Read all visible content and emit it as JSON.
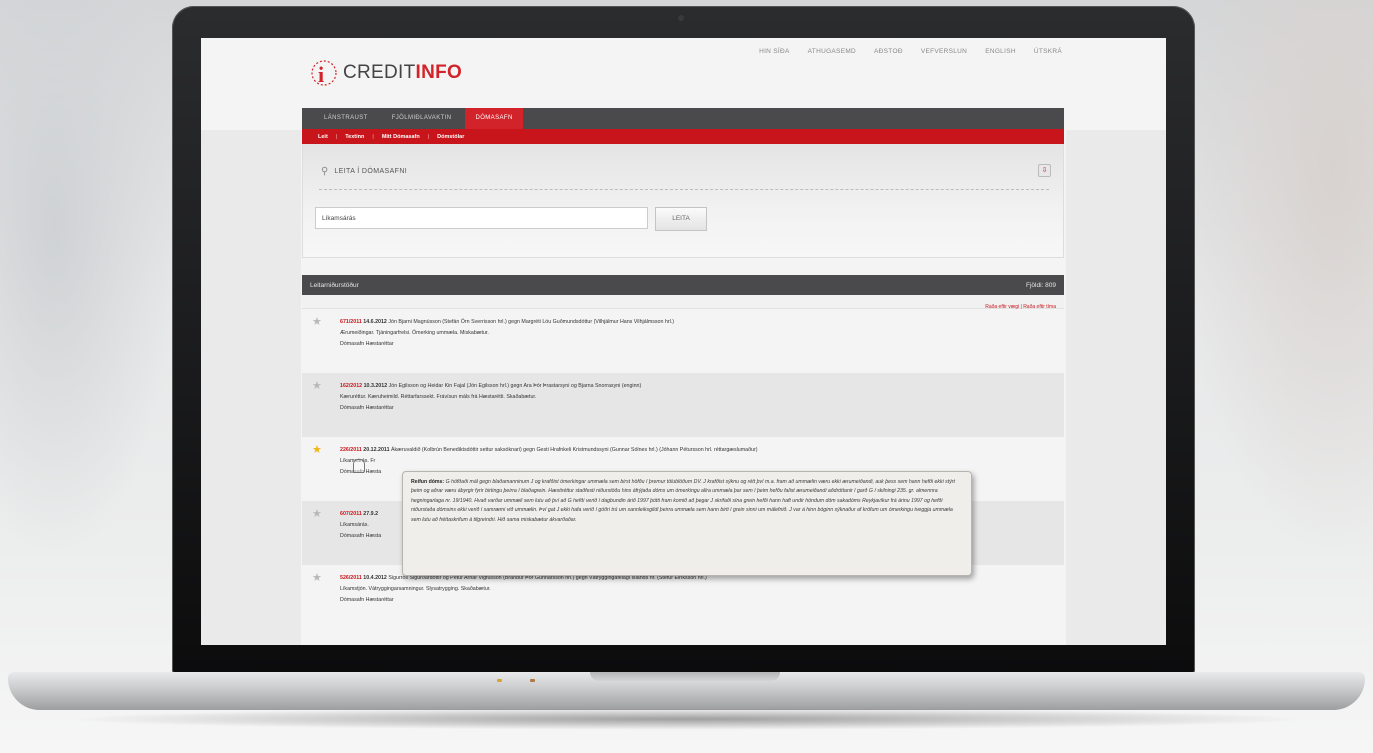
{
  "site": {
    "logo_prefix": "CREDIT",
    "logo_suffix": "INFO",
    "logo_mark": "i",
    "top_nav": [
      "HIN SÍÐA",
      "ATHUGASEMD",
      "AÐSTOÐ",
      "VEFVERSLUN",
      "ENGLISH",
      "ÚTSKRÁ"
    ]
  },
  "tabs": [
    {
      "label": "LÁNSTRAUST",
      "active": false
    },
    {
      "label": "FJÖLMIÐLAVAKTIN",
      "active": false
    },
    {
      "label": "DÓMASAFN",
      "active": true
    }
  ],
  "subnav": [
    "Leit",
    "Textinn",
    "Mitt Dómasafn",
    "Dómstólar"
  ],
  "search": {
    "title": "LEITA Í DÓMASAFNI",
    "query": "Líkamsárás",
    "button": "LEITA",
    "download_icon": "download-icon",
    "wrench_icon": "wrench-icon"
  },
  "results": {
    "header": "Leitarniðurstöður",
    "count_label": "Fjöldi: 809",
    "sort_links": "Raða eftir vægi | Raða eftir tíma",
    "items": [
      {
        "id": "671/2011",
        "date": "14.6.2012",
        "parties": "Jón Bjarni Magnússon (Stefán Örn Sverrisson hrl.) gegn Margréti Lóu Guðmundsdóttur (Vilhjálmur Hans Vilhjálmsson hrl.)",
        "keywords": "Ærumeiðingar. Tjáningarfrelsi. Ómerking ummæla. Miskabætur.",
        "source": "Dómasafn Hæstaréttar",
        "favorite": false
      },
      {
        "id": "162/2012",
        "date": "10.3.2012",
        "parties": "Jón Egilsson og Heidar Kin Fajal (Jón Egilsson hrl.) gegn Ara Þór Þrastarsyni og Bjarna Snorrasyni (enginn)",
        "keywords": "Kæruréttur. Kæruheimild. Réttarfarssekt. Frávísun máls frá Hæstarétti. Skaðabætur.",
        "source": "Dómasafn Hæstaréttar",
        "favorite": false
      },
      {
        "id": "226/2011",
        "date": "20.12.2011",
        "parties": "Ákæruvaldið (Kolbrún Benediktsdóttir settur saksóknari) gegn Gesti Hrafnkeli Kristmundssyni (Gunnar Sólnes hrl.) (Jóhann Pétursson hrl. réttargæslumaður)",
        "keywords": "Líkamsárás. Fr",
        "source": "Dómasafn Hæsta",
        "favorite": true
      },
      {
        "id": "607/2011",
        "date": "27.9.2",
        "parties": "",
        "keywords": "Líkamsárás.",
        "source": "Dómasafn Hæsta",
        "favorite": false
      },
      {
        "id": "526/2011",
        "date": "10.4.2012",
        "parties": "Sigurrós Sigurðardóttir og Pétur Arnar Vigfússon (Brandur Þór Gunnarsson hrl.) gegn Vátryggingafélagi Íslands hf. (Stefur Eiríksson hrl.)",
        "keywords": "Líkamstjón. Vátryggingarsamningur. Slysatrygging. Skaðabætur.",
        "source": "Dómasafn Hæstaréttar",
        "favorite": false
      }
    ]
  },
  "tooltip": {
    "label": "Reifun dóms:",
    "text": "G höfðaði mál gegn blaðamanninum J og krafðist ómerkingar ummæla sem birst höfðu í þremur tölublöðum DV. J krafðist sýknu og rétt því m.a. fram að ummælin væru ekki ærumeiðandi, auk þess sem hann hefði ekki stýrt þeim og aðrar væru ábyrgir fyrir birtingu þeirra í blaðagrein. Hæstiréttur staðfesti niðurstöðu hins áfrýjaða dóms um ómerkingu allra ummæla þar sem í þeim hefðu falist ærumeiðandi aðdróttanir í garð G í skilningi 235. gr. almennra hegningarlaga nr. 19/1940. Hvað varðar ummæli sem lutu að því að G hefði verið í dagbundin árið 1997 þótti fram komið að þegar J skrifaði sína grein hefði hann haft undir höndum dóm sakadóms Reykjavíkur frá árinu 1997 og hefði niðurstaða dómsins ekki verið í samræmi við ummælin. Því gat J ekki hafa verið í góðri trú um sannleiksgildi þeirra ummæla sem hann birti í grein sinni um málefnið. J var á hinn bóginn sýknaður af kröfum um ómerkingu tveggja ummæla sem lutu að fréttaskrifum á tilgreindri. Hið sama miskabætur ákvarðaðar."
  },
  "colors": {
    "brand_red": "#d2232a",
    "dark_bar": "#4a4a4c",
    "star_favorite": "#f1b516"
  }
}
